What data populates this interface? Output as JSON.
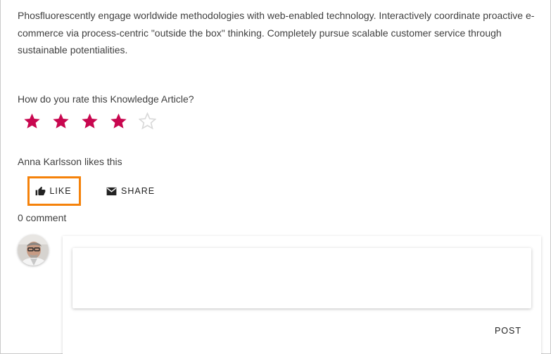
{
  "article": {
    "description": "Phosfluorescently engage worldwide methodologies with web-enabled technology. Interactively coordinate proactive e-commerce via process-centric \"outside the box\" thinking. Completely pursue scalable customer service through sustainable potentialities."
  },
  "rating": {
    "question": "How do you rate this Knowledge Article?",
    "value": 4,
    "max": 5,
    "filled_color": "#c8074f",
    "empty_color": "#d9d9d9"
  },
  "social": {
    "likes_text": "Anna Karlsson likes this",
    "like_label": "LIKE",
    "share_label": "SHARE",
    "highlight_color": "#f5820a"
  },
  "comments": {
    "count_text": "0 comment",
    "input_value": "",
    "post_label": "POST"
  }
}
